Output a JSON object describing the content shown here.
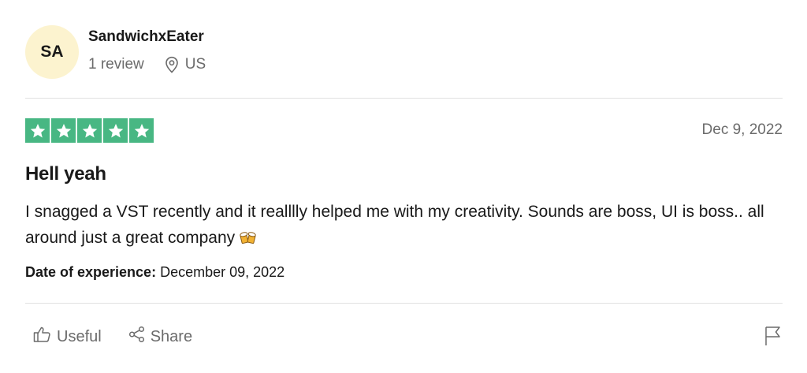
{
  "reviewer": {
    "initials": "SA",
    "name": "SandwichxEater",
    "review_count": "1 review",
    "country": "US",
    "avatar_color": "#fcf3cf"
  },
  "review": {
    "rating": 5,
    "rating_max": 5,
    "star_color": "#48b783",
    "date": "Dec 9, 2022",
    "title": "Hell yeah",
    "body": "I snagged a VST recently and it realllly helped me with my creativity. Sounds are boss, UI is boss.. all around just a great company",
    "experience_label": "Date of experience:",
    "experience_date": "December 09, 2022"
  },
  "actions": {
    "useful_label": "Useful",
    "share_label": "Share"
  },
  "icons": [
    "location-pin-icon",
    "star-icon",
    "beer-mugs-icon",
    "thumbs-up-icon",
    "share-icon",
    "flag-icon"
  ]
}
